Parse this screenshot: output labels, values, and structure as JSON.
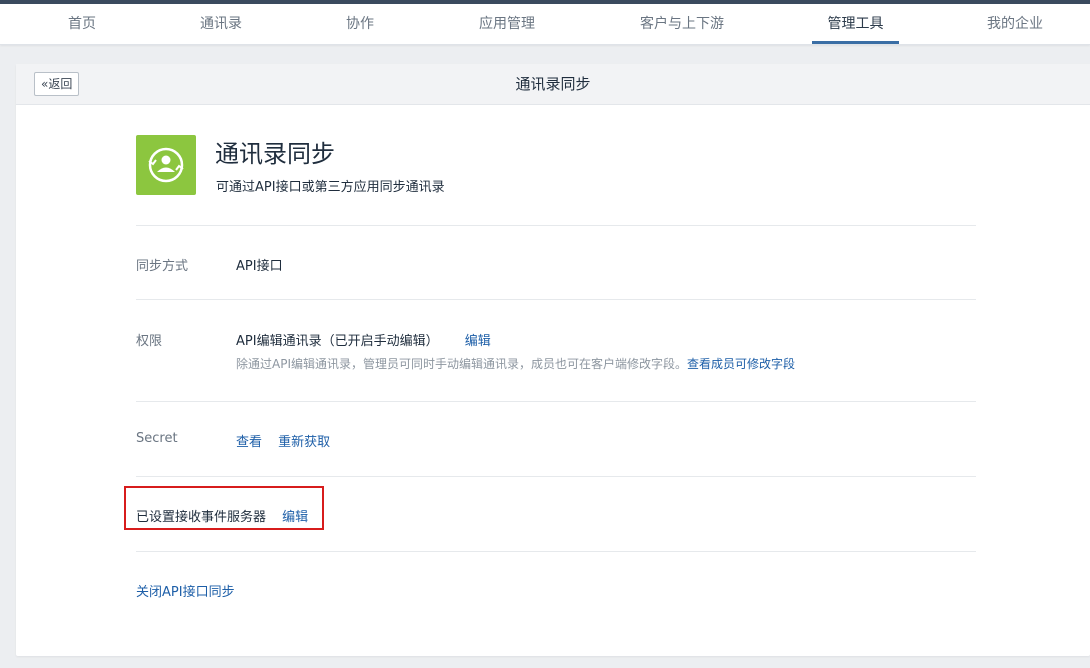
{
  "nav": {
    "items": [
      {
        "label": "首页"
      },
      {
        "label": "通讯录"
      },
      {
        "label": "协作"
      },
      {
        "label": "应用管理"
      },
      {
        "label": "客户与上下游"
      },
      {
        "label": "管理工具"
      },
      {
        "label": "我的企业"
      }
    ],
    "active": "管理工具"
  },
  "header": {
    "back_label": "返回",
    "title": "通讯录同步"
  },
  "app": {
    "title": "通讯录同步",
    "description": "可通过API接口或第三方应用同步通讯录",
    "icon": "contact-sync-icon",
    "icon_color": "#8cc63f"
  },
  "settings": {
    "sync_mode": {
      "label": "同步方式",
      "value": "API接口"
    },
    "permission": {
      "label": "权限",
      "value": "API编辑通讯录（已开启手动编辑）",
      "edit_label": "编辑",
      "hint": "除通过API编辑通讯录，管理员可同时手动编辑通讯录，成员也可在客户端修改字段。",
      "hint_link": "查看成员可修改字段"
    },
    "secret": {
      "label": "Secret",
      "view_label": "查看",
      "refresh_label": "重新获取"
    },
    "event_server": {
      "label": "已设置接收事件服务器",
      "edit_label": "编辑"
    },
    "close_link": "关闭API接口同步"
  },
  "colors": {
    "link": "#1e5fa8",
    "highlight": "#d71c1c",
    "accent": "#3a6ea5"
  }
}
